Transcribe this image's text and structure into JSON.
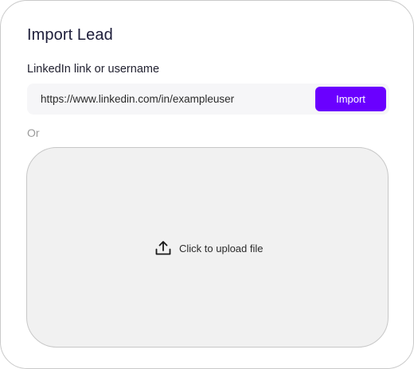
{
  "dialog": {
    "title": "Import Lead"
  },
  "linkedin": {
    "label": "LinkedIn link or username",
    "value": "https://www.linkedin.com/in/exampleuser",
    "import_label": "Import"
  },
  "separator": {
    "text": "Or"
  },
  "upload": {
    "icon": "upload-icon",
    "label": "Click to upload file"
  },
  "colors": {
    "accent": "#6a00ff",
    "dropzone_bg": "#f1f1f1",
    "input_bg": "#f6f6f8",
    "title": "#1d1d3a",
    "muted": "#9a9a9a"
  }
}
